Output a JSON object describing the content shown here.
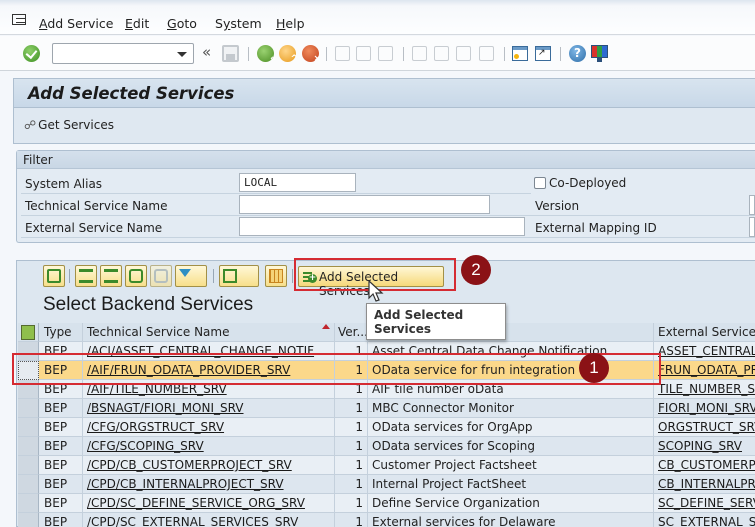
{
  "menubar": {
    "items": [
      {
        "label_u": "A",
        "label_rest": "dd Service"
      },
      {
        "label_u": "E",
        "label_rest": "dit"
      },
      {
        "label_u": "G",
        "label_rest": "oto"
      },
      {
        "label_pre": "S",
        "label_u": "y",
        "label_rest": "stem"
      },
      {
        "label_u": "H",
        "label_rest": "elp"
      }
    ]
  },
  "toolbar": {
    "command_field_value": "",
    "back_glyph": "«",
    "help_glyph": "?"
  },
  "title": "Add Selected Services",
  "app_toolbar": {
    "get_services_label": "Get Services",
    "get_services_glyph": "☍"
  },
  "filter": {
    "header": "Filter",
    "system_alias_label": "System Alias",
    "system_alias_value": "LOCAL",
    "technical_service_name_label": "Technical Service Name",
    "technical_service_name_value": "",
    "external_service_name_label": "External Service Name",
    "external_service_name_value": "",
    "co_deployed_label": "Co-Deployed",
    "co_deployed_checked": false,
    "version_label": "Version",
    "external_mapping_id_label": "External Mapping ID"
  },
  "alv": {
    "add_selected_label": "Add Selected Services",
    "title": "Select Backend Services",
    "tooltip": "Add Selected Services",
    "columns": {
      "type": "Type",
      "technical_service_name": "Technical Service Name",
      "version": "Ver...",
      "description": "",
      "external_service_name": "External Service N"
    },
    "rows": [
      {
        "type": "BEP",
        "tech": "/ACI/ASSET_CENTRAL_CHANGE_NOTIF",
        "ver": "1",
        "desc": "Asset Central Data Change Notification",
        "ext": "ASSET_CENTRAL_",
        "selected": false
      },
      {
        "type": "BEP",
        "tech": "/AIF/FRUN_ODATA_PROVIDER_SRV",
        "ver": "1",
        "desc": "OData service for frun integration",
        "ext": "FRUN_ODATA_PR",
        "selected": true
      },
      {
        "type": "BEP",
        "tech": "/AIF/TILE_NUMBER_SRV",
        "ver": "1",
        "desc": "AIF tile number oData",
        "ext": "TILE_NUMBER_SR",
        "selected": false
      },
      {
        "type": "BEP",
        "tech": "/BSNAGT/FIORI_MONI_SRV",
        "ver": "1",
        "desc": "MBC Connector Monitor",
        "ext": "FIORI_MONI_SRV",
        "selected": false
      },
      {
        "type": "BEP",
        "tech": "/CFG/ORGSTRUCT_SRV",
        "ver": "1",
        "desc": "OData services for OrgApp",
        "ext": "ORGSTRUCT_SRV",
        "selected": false
      },
      {
        "type": "BEP",
        "tech": "/CFG/SCOPING_SRV",
        "ver": "1",
        "desc": "OData services for Scoping",
        "ext": "SCOPING_SRV",
        "selected": false
      },
      {
        "type": "BEP",
        "tech": "/CPD/CB_CUSTOMERPROJECT_SRV",
        "ver": "1",
        "desc": "Customer Project Factsheet",
        "ext": "CB_CUSTOMERPR",
        "selected": false
      },
      {
        "type": "BEP",
        "tech": "/CPD/CB_INTERNALPROJECT_SRV",
        "ver": "1",
        "desc": "Internal Project FactSheet",
        "ext": "CB_INTERNALPRO",
        "selected": false
      },
      {
        "type": "BEP",
        "tech": "/CPD/SC_DEFINE_SERVICE_ORG_SRV",
        "ver": "1",
        "desc": "Define Service Organization",
        "ext": "SC_DEFINE_SERV",
        "selected": false
      },
      {
        "type": "BEP",
        "tech": "/CPD/SC_EXTERNAL_SERVICES_SRV",
        "ver": "1",
        "desc": "External services for Delaware",
        "ext": "SC_EXTERNAL_SE",
        "selected": false
      }
    ]
  },
  "annotations": {
    "badge_1": "1",
    "badge_2": "2",
    "highlight_color": "#d52b32",
    "badge_color": "#8b1216",
    "selected_row_color": "#fbd88a"
  }
}
